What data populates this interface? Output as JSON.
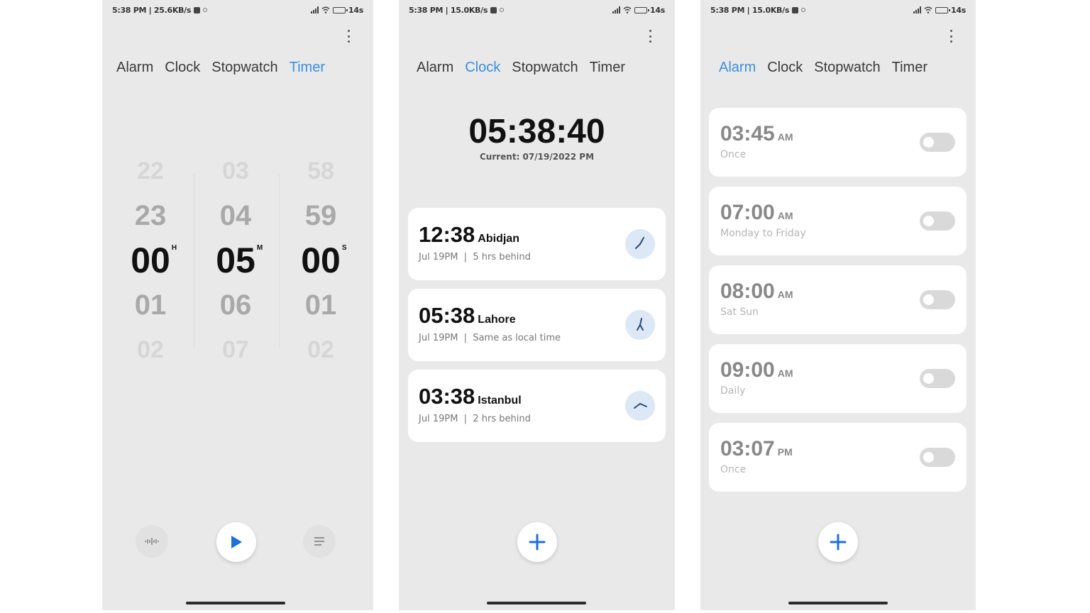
{
  "status": {
    "left": {
      "text": "5:38 PM | 25.6KB/s"
    },
    "middle": {
      "text": "5:38 PM | 15.0KB/s"
    },
    "right": {
      "text": "5:38 PM | 15.0KB/s"
    },
    "battery": "14s"
  },
  "tabs": [
    "Alarm",
    "Clock",
    "Stopwatch",
    "Timer"
  ],
  "timer": {
    "hours": {
      "above2": "22",
      "above1": "23",
      "selected": "00",
      "below1": "01",
      "below2": "02",
      "unit": "H"
    },
    "minutes": {
      "above2": "03",
      "above1": "04",
      "selected": "05",
      "below1": "06",
      "below2": "07",
      "unit": "M"
    },
    "seconds": {
      "above2": "58",
      "above1": "59",
      "selected": "00",
      "below1": "01",
      "below2": "02",
      "unit": "S"
    }
  },
  "clock": {
    "time": "05:38:40",
    "current": "Current: 07/19/2022 PM",
    "cities": [
      {
        "time": "12:38",
        "city": "Abidjan",
        "date": "Jul 19PM",
        "diff": "5 hrs behind"
      },
      {
        "time": "05:38",
        "city": "Lahore",
        "date": "Jul 19PM",
        "diff": "Same as local time"
      },
      {
        "time": "03:38",
        "city": "Istanbul",
        "date": "Jul 19PM",
        "diff": "2 hrs behind"
      }
    ]
  },
  "alarms": [
    {
      "time": "03:45",
      "ampm": "AM",
      "repeat": "Once",
      "enabled": false
    },
    {
      "time": "07:00",
      "ampm": "AM",
      "repeat": "Monday to Friday",
      "enabled": false
    },
    {
      "time": "08:00",
      "ampm": "AM",
      "repeat": "Sat Sun",
      "enabled": false
    },
    {
      "time": "09:00",
      "ampm": "AM",
      "repeat": "Daily",
      "enabled": false
    },
    {
      "time": "03:07",
      "ampm": "PM",
      "repeat": "Once",
      "enabled": false
    }
  ],
  "icons": {
    "play": "play-icon",
    "sound": "sound-icon",
    "list": "list-icon",
    "add": "add-icon",
    "menu": "more-vert-icon"
  },
  "colors": {
    "accent": "#3a8fe0",
    "play": "#1e6fd9"
  }
}
